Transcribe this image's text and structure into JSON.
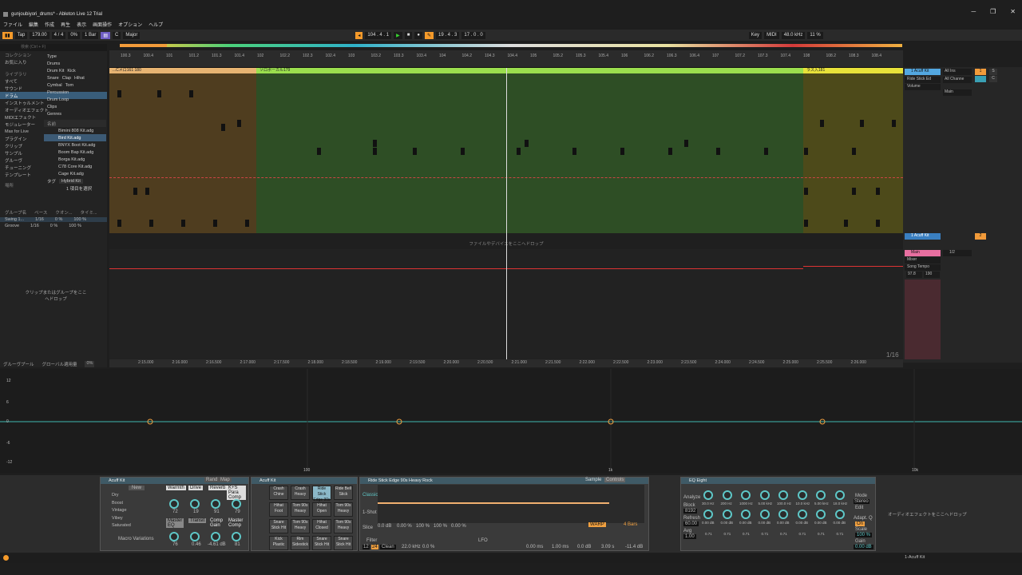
{
  "window": {
    "title": "gunjoubiyori_drums* - Ableton Live 12 Trial",
    "min": "─",
    "max": "❐",
    "close": "✕"
  },
  "menu": [
    "ファイル",
    "編集",
    "作成",
    "再生",
    "表示",
    "画面操作",
    "オプション",
    "ヘルプ"
  ],
  "transport": {
    "tap": "Tap",
    "tempo": "179.00",
    "sig": "4 / 4",
    "pct": "0%",
    "bar": "1 Bar",
    "key": "C",
    "scale": "Major",
    "position": "104 .  4 .  1",
    "loop_start": "19 .  4 .  3",
    "loop_len": "17 .  0 .  0",
    "key_label": "Key",
    "midi_label": "MIDI",
    "cpu": "48.0 kHz",
    "cpu_pct": "11 %"
  },
  "browser": {
    "search_placeholder": "検索 (Ctrl + F)",
    "collections_label": "コレクション",
    "favorites": "お気に入り",
    "library_label": "ライブラリ",
    "categories": [
      "すべて",
      "サウンド",
      "ドラム",
      "インストゥルメント",
      "オーディオエフェクト",
      "MIDIエフェクト",
      "モジュレーター",
      "Max for Live",
      "プラグイン",
      "クリップ",
      "サンプル",
      "グルーヴ",
      "チューニング",
      "テンプレート"
    ],
    "places_label": "場所",
    "filters": {
      "type": "Type",
      "drums": "Drums",
      "drumkit": "Drum Kit",
      "kick": "Kick",
      "snare": "Snare",
      "clap": "Clap",
      "hihat": "Hihat",
      "cymbal": "Cymbal",
      "tom": "Tom",
      "percussion": "Percussion",
      "drumloop": "Drum Loop",
      "clips": "Clips",
      "genres": "Genres"
    },
    "name_header": "名前",
    "files": [
      "Bimini 808 Kit.adg",
      "Bird Kit.adg",
      "BNYX Boot Kit.adg",
      "Boom Bap Kit.adg",
      "Borga Kit.adg",
      "C78 Core Kit.adg",
      "Cage Kit.adg"
    ],
    "tag_label": "タグ",
    "tag_value": "Hybrid Kit",
    "select_hint": "1 項目を選択"
  },
  "groove": {
    "headers": [
      "グループ名",
      "ベース",
      "クオン...",
      "タイミ..."
    ],
    "rows": [
      [
        "Swing 1...",
        "1/16",
        "0 %",
        "100 %"
      ],
      [
        "Groove",
        "1/16",
        "0 %",
        "100 %"
      ]
    ],
    "pool": "グルーヴプール",
    "global": "グローバル適用量",
    "global_val": "0%",
    "drop_hint": "クリップまたはグループをここへドロップ"
  },
  "ruler": {
    "ticks": [
      "100.3",
      "100.4",
      "101",
      "101.2",
      "101.3",
      "101.4",
      "102",
      "102.2",
      "102.3",
      "102.4",
      "103",
      "103.2",
      "103.3",
      "103.4",
      "104",
      "104.2",
      "104.3",
      "104.4",
      "105",
      "105.2",
      "105.3",
      "105.4",
      "106",
      "106.2",
      "106.3",
      "106.4",
      "107",
      "107.2",
      "107.3",
      "107.4",
      "108",
      "108.2",
      "108.3",
      "108.4"
    ],
    "times": [
      "2:15.000",
      "2:16.000",
      "2:16.500",
      "2:17.000",
      "2:17.500",
      "2:18.000",
      "2:18.500",
      "2:19.000",
      "2:19.500",
      "2:20.000",
      "2:20.500",
      "2:21.000",
      "2:21.500",
      "2:22.000",
      "2:22.500",
      "2:23.000",
      "2:23.500",
      "2:24.000",
      "2:24.500",
      "2:25.000",
      "2:25.500",
      "2:26.000"
    ]
  },
  "clips": {
    "a": "...Cメロ161  180",
    "b": "ソロボーカル179",
    "c": "ラス入181"
  },
  "drop_files": "ファイルやデバイスをここへドロップ",
  "quant": "1/16",
  "mixer": {
    "track1": "1 Acuff Kit",
    "in": "All Ins",
    "ch": "All Channe",
    "rs": "Ride Stick Ed",
    "vol": "Volume",
    "main": "Main",
    "audio": "2 Audio",
    "master": "Main",
    "mixer": "Mixer",
    "song_tempo": "Song Tempo",
    "t1": "97.8",
    "t2": "190",
    "s": "S",
    "n2": "2",
    "n1": "1",
    "c": "C",
    "half": "1/2"
  },
  "env": {
    "y_top": "12",
    "y_mid": "6",
    "y_zero": "0",
    "y_m6": "-6",
    "y_m12": "-12",
    "x_100": "100",
    "x_1k": "1k",
    "x_10k": "10k"
  },
  "devices": {
    "drumbuss": {
      "title": "Acuff Kit",
      "new": "New",
      "rand": "Rand",
      "map": "Map",
      "items": [
        "Dry",
        "Boost",
        "Vintage",
        "Vibey",
        "Saturated"
      ],
      "knobs": [
        "Warmth",
        "Drive",
        "Reverb",
        "K+S Para Comp"
      ],
      "vals": [
        "72",
        "19",
        "91",
        "79"
      ],
      "knobs2": [
        "Master EQ",
        "Transit",
        "Comp Gain",
        "Master Comp"
      ],
      "vals2": [
        "76",
        "0.46",
        "-4.61 dB",
        "81"
      ],
      "macro": "Macro Variations"
    },
    "rack": {
      "title": "Acuff Kit",
      "pads": [
        "Crash Chine",
        "Crash Heavy",
        "Ride Stick Edge 90s",
        "Ride Bell Stick",
        "Hihat Foot",
        "Tom 90s Heavy",
        "Hihat Open",
        "Tom 90s Heavy",
        "Snare Stick Hit",
        "Tom 90s Heavy",
        "Hihat Closed",
        "Tom 90s Heavy",
        "Kick Plastic",
        "Rim Sidestick",
        "Snare Stick Hit",
        "Snare Stick Hit"
      ]
    },
    "sampler": {
      "title": "Ride Stick Edge 90s Heavy Rock",
      "sample": "Sample",
      "controls": "Controls",
      "classic": "Classic",
      "oneshot": "1-Shot",
      "slice": "Slice",
      "gain": "0.0 dB",
      "start": "0.00 %",
      "loop": "100 %",
      "length": "100 %",
      "fade": "0.00 %",
      "warp": "WARP",
      "bars": "4 Bars",
      "filter": "Filter",
      "clean": "Clean",
      "freq": "22.0 kHz",
      "res": "0.0 %",
      "lfo": "LFO",
      "attack": "0.00 ms",
      "decay": "1.00 ms",
      "sustain": "0.0 dB",
      "release": "3.09 s",
      "volume": "-11.4 dB",
      "l12": "12",
      "l24": "24"
    },
    "eq": {
      "title": "EQ Eight",
      "analyze": "Analyze",
      "block": "Block",
      "b8192": "8192",
      "refresh": "Refresh",
      "r60": "60.00",
      "avg": "Avg",
      "a1": "1.00",
      "freqs": [
        "30.0 Hz",
        "200 Hz",
        "1000 Hz",
        "5.00 kHz",
        "100.0 Hz",
        "10.0 kHz",
        "5.00 kHz",
        "18.0 kHz"
      ],
      "gains": [
        "0.00 dB",
        "0.00 dB",
        "0.00 dB",
        "0.00 dB",
        "0.00 dB",
        "0.00 dB",
        "0.00 dB",
        "0.00 dB"
      ],
      "q": [
        "0.71",
        "0.71",
        "0.71",
        "0.71",
        "0.71",
        "0.71",
        "0.71",
        "0.71"
      ],
      "mode": "Mode",
      "stereo": "Stereo",
      "edit": "Edit",
      "adapt": "Adapt. Q",
      "on": "On",
      "scale": "Scale",
      "s100": "100 %",
      "gain": "Gain",
      "g0": "0.00 dB"
    },
    "drop_fx": "オーディオエフェクトをここへドロップ"
  },
  "status": {
    "track": "1-Acuff Kit"
  },
  "counter": "1/16"
}
